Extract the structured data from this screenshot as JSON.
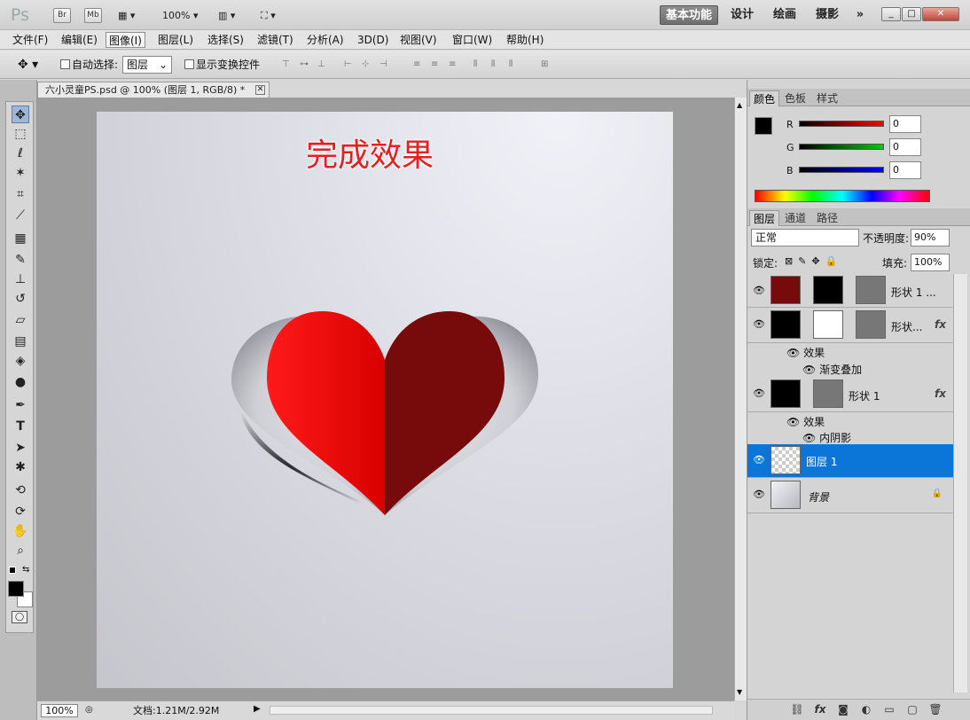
{
  "app": {
    "logo": "Ps",
    "br": "Br",
    "mb": "Mb",
    "zoom_dropdown": "100%",
    "workspaces": [
      "基本功能",
      "设计",
      "绘画",
      "摄影"
    ],
    "more": "»"
  },
  "window_controls": {
    "minimize": "_",
    "restore": "□",
    "close": "✕"
  },
  "menu": [
    "文件(F)",
    "编辑(E)",
    "图像(I)",
    "图层(L)",
    "选择(S)",
    "滤镜(T)",
    "分析(A)",
    "3D(D)",
    "视图(V)",
    "窗口(W)",
    "帮助(H)"
  ],
  "options": {
    "auto_select_label": "自动选择:",
    "auto_select_value": "图层",
    "show_transform_label": "显示变换控件"
  },
  "document": {
    "tab_title": "六小灵童PS.psd @ 100% (图层 1, RGB/8) *",
    "tab_close": "✕",
    "canvas_title": "完成效果"
  },
  "status": {
    "zoom": "100%",
    "doc_info": "文档:1.21M/2.92M"
  },
  "color_panel": {
    "tabs": [
      "颜色",
      "色板",
      "样式"
    ],
    "channels": [
      {
        "label": "R",
        "value": "0",
        "color": "#ff0000"
      },
      {
        "label": "G",
        "value": "0",
        "color": "#00cc00"
      },
      {
        "label": "B",
        "value": "0",
        "color": "#0000ff"
      }
    ]
  },
  "layers_panel": {
    "tabs": [
      "图层",
      "通道",
      "路径"
    ],
    "blend_mode": "正常",
    "opacity_label": "不透明度:",
    "opacity_value": "90%",
    "lock_label": "锁定:",
    "fill_label": "填充:",
    "fill_value": "100%",
    "layers": [
      {
        "name": "形状 1 ...",
        "fx": ""
      },
      {
        "name": "形状...",
        "fx": "fx",
        "effects_label": "效果",
        "effect": "渐变叠加"
      },
      {
        "name": "形状 1",
        "fx": "fx",
        "effects_label": "效果",
        "effect": "内阴影"
      },
      {
        "name": "图层 1"
      },
      {
        "name": "背景"
      }
    ]
  },
  "accent": "#0b76d8"
}
